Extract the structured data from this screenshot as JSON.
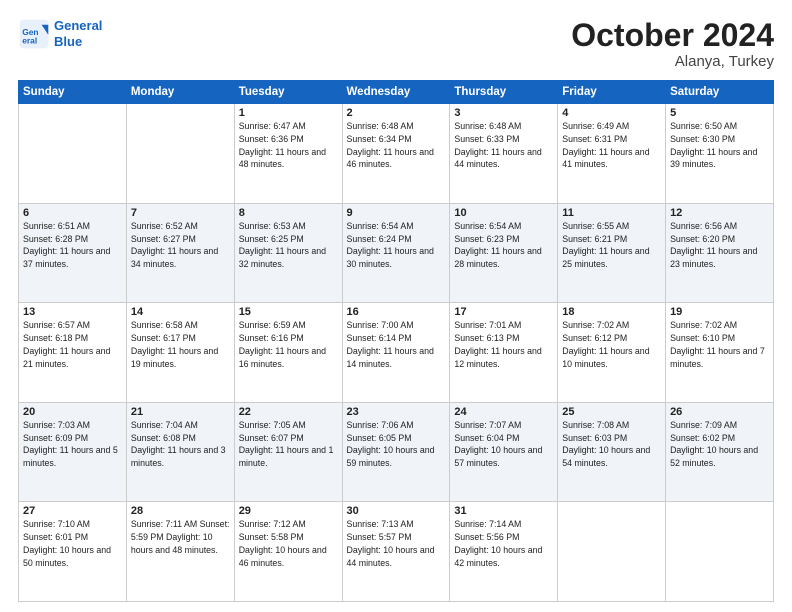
{
  "logo": {
    "line1": "General",
    "line2": "Blue"
  },
  "header": {
    "month": "October 2024",
    "location": "Alanya, Turkey"
  },
  "weekdays": [
    "Sunday",
    "Monday",
    "Tuesday",
    "Wednesday",
    "Thursday",
    "Friday",
    "Saturday"
  ],
  "weeks": [
    [
      {
        "day": "",
        "info": ""
      },
      {
        "day": "",
        "info": ""
      },
      {
        "day": "1",
        "info": "Sunrise: 6:47 AM\nSunset: 6:36 PM\nDaylight: 11 hours and 48 minutes."
      },
      {
        "day": "2",
        "info": "Sunrise: 6:48 AM\nSunset: 6:34 PM\nDaylight: 11 hours and 46 minutes."
      },
      {
        "day": "3",
        "info": "Sunrise: 6:48 AM\nSunset: 6:33 PM\nDaylight: 11 hours and 44 minutes."
      },
      {
        "day": "4",
        "info": "Sunrise: 6:49 AM\nSunset: 6:31 PM\nDaylight: 11 hours and 41 minutes."
      },
      {
        "day": "5",
        "info": "Sunrise: 6:50 AM\nSunset: 6:30 PM\nDaylight: 11 hours and 39 minutes."
      }
    ],
    [
      {
        "day": "6",
        "info": "Sunrise: 6:51 AM\nSunset: 6:28 PM\nDaylight: 11 hours and 37 minutes."
      },
      {
        "day": "7",
        "info": "Sunrise: 6:52 AM\nSunset: 6:27 PM\nDaylight: 11 hours and 34 minutes."
      },
      {
        "day": "8",
        "info": "Sunrise: 6:53 AM\nSunset: 6:25 PM\nDaylight: 11 hours and 32 minutes."
      },
      {
        "day": "9",
        "info": "Sunrise: 6:54 AM\nSunset: 6:24 PM\nDaylight: 11 hours and 30 minutes."
      },
      {
        "day": "10",
        "info": "Sunrise: 6:54 AM\nSunset: 6:23 PM\nDaylight: 11 hours and 28 minutes."
      },
      {
        "day": "11",
        "info": "Sunrise: 6:55 AM\nSunset: 6:21 PM\nDaylight: 11 hours and 25 minutes."
      },
      {
        "day": "12",
        "info": "Sunrise: 6:56 AM\nSunset: 6:20 PM\nDaylight: 11 hours and 23 minutes."
      }
    ],
    [
      {
        "day": "13",
        "info": "Sunrise: 6:57 AM\nSunset: 6:18 PM\nDaylight: 11 hours and 21 minutes."
      },
      {
        "day": "14",
        "info": "Sunrise: 6:58 AM\nSunset: 6:17 PM\nDaylight: 11 hours and 19 minutes."
      },
      {
        "day": "15",
        "info": "Sunrise: 6:59 AM\nSunset: 6:16 PM\nDaylight: 11 hours and 16 minutes."
      },
      {
        "day": "16",
        "info": "Sunrise: 7:00 AM\nSunset: 6:14 PM\nDaylight: 11 hours and 14 minutes."
      },
      {
        "day": "17",
        "info": "Sunrise: 7:01 AM\nSunset: 6:13 PM\nDaylight: 11 hours and 12 minutes."
      },
      {
        "day": "18",
        "info": "Sunrise: 7:02 AM\nSunset: 6:12 PM\nDaylight: 11 hours and 10 minutes."
      },
      {
        "day": "19",
        "info": "Sunrise: 7:02 AM\nSunset: 6:10 PM\nDaylight: 11 hours and 7 minutes."
      }
    ],
    [
      {
        "day": "20",
        "info": "Sunrise: 7:03 AM\nSunset: 6:09 PM\nDaylight: 11 hours and 5 minutes."
      },
      {
        "day": "21",
        "info": "Sunrise: 7:04 AM\nSunset: 6:08 PM\nDaylight: 11 hours and 3 minutes."
      },
      {
        "day": "22",
        "info": "Sunrise: 7:05 AM\nSunset: 6:07 PM\nDaylight: 11 hours and 1 minute."
      },
      {
        "day": "23",
        "info": "Sunrise: 7:06 AM\nSunset: 6:05 PM\nDaylight: 10 hours and 59 minutes."
      },
      {
        "day": "24",
        "info": "Sunrise: 7:07 AM\nSunset: 6:04 PM\nDaylight: 10 hours and 57 minutes."
      },
      {
        "day": "25",
        "info": "Sunrise: 7:08 AM\nSunset: 6:03 PM\nDaylight: 10 hours and 54 minutes."
      },
      {
        "day": "26",
        "info": "Sunrise: 7:09 AM\nSunset: 6:02 PM\nDaylight: 10 hours and 52 minutes."
      }
    ],
    [
      {
        "day": "27",
        "info": "Sunrise: 7:10 AM\nSunset: 6:01 PM\nDaylight: 10 hours and 50 minutes."
      },
      {
        "day": "28",
        "info": "Sunrise: 7:11 AM\nSunset: 5:59 PM\nDaylight: 10 hours and 48 minutes."
      },
      {
        "day": "29",
        "info": "Sunrise: 7:12 AM\nSunset: 5:58 PM\nDaylight: 10 hours and 46 minutes."
      },
      {
        "day": "30",
        "info": "Sunrise: 7:13 AM\nSunset: 5:57 PM\nDaylight: 10 hours and 44 minutes."
      },
      {
        "day": "31",
        "info": "Sunrise: 7:14 AM\nSunset: 5:56 PM\nDaylight: 10 hours and 42 minutes."
      },
      {
        "day": "",
        "info": ""
      },
      {
        "day": "",
        "info": ""
      }
    ]
  ]
}
